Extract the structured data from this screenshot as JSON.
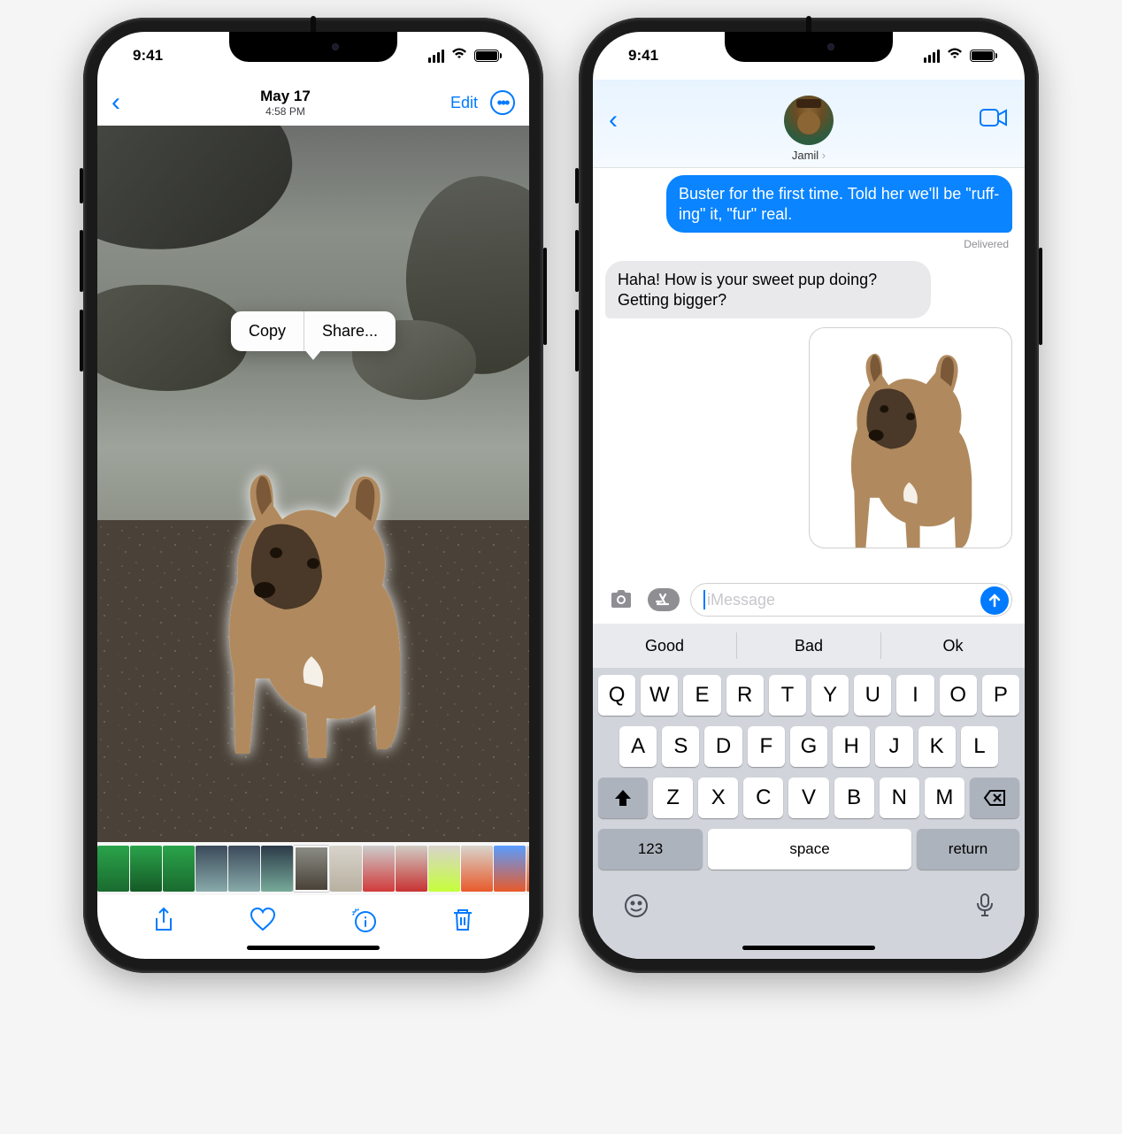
{
  "status": {
    "time": "9:41"
  },
  "photos": {
    "title": "May 17",
    "subtitle": "4:58 PM",
    "edit_label": "Edit",
    "popover": {
      "copy": "Copy",
      "share": "Share..."
    }
  },
  "messages": {
    "contact_name": "Jamil",
    "sent_text": "Buster for the first time. Told her we'll be \"ruff-ing\" it, \"fur\" real.",
    "delivered_label": "Delivered",
    "received_text": "Haha! How is your sweet pup doing? Getting bigger?",
    "input_placeholder": "iMessage"
  },
  "keyboard": {
    "predictions": [
      "Good",
      "Bad",
      "Ok"
    ],
    "row1": [
      "Q",
      "W",
      "E",
      "R",
      "T",
      "Y",
      "U",
      "I",
      "O",
      "P"
    ],
    "row2": [
      "A",
      "S",
      "D",
      "F",
      "G",
      "H",
      "J",
      "K",
      "L"
    ],
    "row3": [
      "Z",
      "X",
      "C",
      "V",
      "B",
      "N",
      "M"
    ],
    "numbers_label": "123",
    "space_label": "space",
    "return_label": "return"
  }
}
